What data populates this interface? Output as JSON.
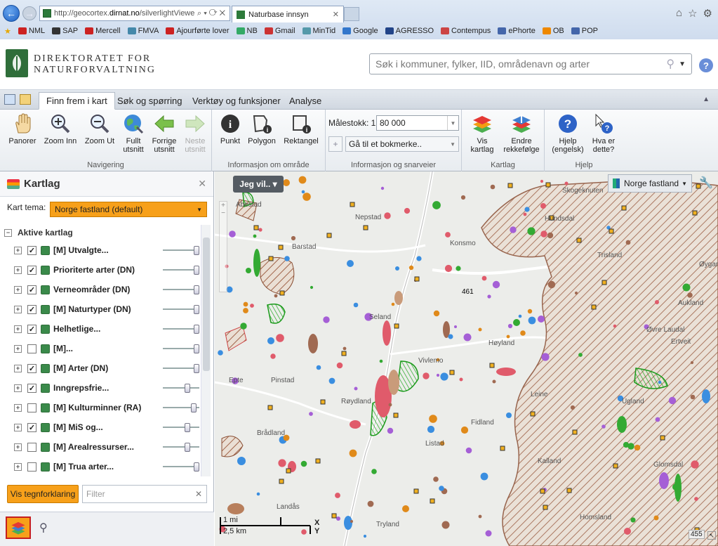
{
  "browser": {
    "url_prefix": "http://geocortex.",
    "url_domain": "dirnat.no",
    "url_suffix": "/silverlightViewe",
    "tab_title": "Naturbase innsyn",
    "favorites": [
      "NML",
      "SAP",
      "Mercell",
      "FMVA",
      "Ajourførte lover",
      "NB",
      "Gmail",
      "MinTid",
      "Google",
      "AGRESSO",
      "Contempus",
      "ePhorte",
      "OB",
      "POP"
    ]
  },
  "header": {
    "org_line1": "DIREKTORATET FOR",
    "org_line2": "NATURFORVALTNING",
    "search_placeholder": "Søk i kommuner, fylker, IID, områdenavn og arter"
  },
  "ribbon": {
    "tabs": [
      "Finn frem i kart",
      "Søk og spørring",
      "Verktøy og funksjoner",
      "Analyse"
    ],
    "nav_tools": [
      {
        "label": "Panorer",
        "icon": "hand-icon"
      },
      {
        "label": "Zoom Inn",
        "icon": "zoom-in-icon"
      },
      {
        "label": "Zoom Ut",
        "icon": "zoom-out-icon"
      },
      {
        "label": "Fullt utsnitt",
        "icon": "globe-icon"
      },
      {
        "label": "Forrige utsnitt",
        "icon": "arrow-left-icon"
      },
      {
        "label": "Neste utsnitt",
        "icon": "arrow-right-icon"
      }
    ],
    "nav_group": "Navigering",
    "info_tools": [
      "Punkt",
      "Polygon",
      "Rektangel"
    ],
    "info_group": "Informasjon om område",
    "scale_label": "Målestokk: 1:",
    "scale_value": "80 000",
    "bookmark": "Gå til et bokmerke..",
    "shortcuts_group": "Informasjon og snarveier",
    "map_tools": [
      "Vis kartlag",
      "Endre rekkefølge"
    ],
    "map_group": "Kartlag",
    "help_tools": [
      "Hjelp (engelsk)",
      "Hva er dette?"
    ],
    "help_group": "Hjelp"
  },
  "panel": {
    "title": "Kartlag",
    "theme_label": "Kart tema:",
    "theme_value": "Norge fastland (default)",
    "active_layers": "Aktive kartlag",
    "layers": [
      {
        "name": "[M] Utvalgte...",
        "checked": true,
        "opacity": 1.0
      },
      {
        "name": "Prioriterte arter (DN)",
        "checked": true,
        "opacity": 1.0
      },
      {
        "name": "Verneområder (DN)",
        "checked": true,
        "opacity": 1.0
      },
      {
        "name": "[M] Naturtyper (DN)",
        "checked": true,
        "opacity": 1.0
      },
      {
        "name": "Helhetlige...",
        "checked": true,
        "opacity": 1.0
      },
      {
        "name": "[M]...",
        "checked": false,
        "opacity": 1.0
      },
      {
        "name": "[M] Arter (DN)",
        "checked": true,
        "opacity": 1.0
      },
      {
        "name": "Inngrepsfrie...",
        "checked": true,
        "opacity": 0.7
      },
      {
        "name": "[M] Kulturminner (RA)",
        "checked": false,
        "opacity": 0.9
      },
      {
        "name": "[M] MiS og...",
        "checked": true,
        "opacity": 0.7
      },
      {
        "name": "[M] Arealressurser...",
        "checked": false,
        "opacity": 0.7
      },
      {
        "name": "[M] Trua arter...",
        "checked": false,
        "opacity": 1.0
      }
    ],
    "legend_button": "Vis tegnforklaring",
    "filter_placeholder": "Filter"
  },
  "map": {
    "jeg_vil": "Jeg vil..",
    "basemap": "Norge fastland",
    "places": [
      "Abestad",
      "Nepstad",
      "Skogeknuten",
      "Barstad",
      "Hundsdal",
      "Konsmo",
      "Trisland",
      "Øygard",
      "Seland",
      "Aukland",
      "Høyland",
      "Øvre Laudal",
      "Ertveit",
      "Vivlemo",
      "Epte",
      "Røydland",
      "Leine",
      "Fidland",
      "Ugland",
      "Brådland",
      "Listad",
      "Kalland",
      "Glomsdal",
      "Landås",
      "Tryland",
      "Homsland",
      "Pinstad"
    ],
    "road": "461",
    "scale_1": "1 mi",
    "scale_2": "2,5 km",
    "xy": "X\nY",
    "corner_num": "455"
  }
}
